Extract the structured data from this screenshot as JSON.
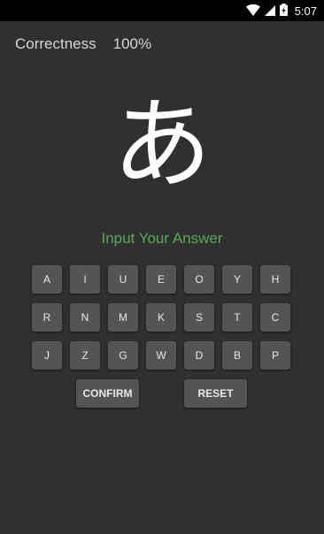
{
  "status_bar": {
    "time": "5:07",
    "icons": [
      "wifi-icon",
      "cell-signal-icon",
      "battery-icon"
    ]
  },
  "score": {
    "label": "Correctness",
    "value": "100%"
  },
  "question": {
    "kana": "あ"
  },
  "prompt": {
    "text": "Input Your Answer"
  },
  "keyboard": {
    "rows": [
      [
        "A",
        "I",
        "U",
        "E",
        "O",
        "Y",
        "H"
      ],
      [
        "R",
        "N",
        "M",
        "K",
        "S",
        "T",
        "C"
      ],
      [
        "J",
        "Z",
        "G",
        "W",
        "D",
        "B",
        "P"
      ]
    ],
    "confirm_label": "CONFIRM",
    "reset_label": "RESET"
  },
  "colors": {
    "background": "#303030",
    "key_background": "#545454",
    "prompt_green": "#5aa55a",
    "text_light": "#d6d6d6"
  }
}
